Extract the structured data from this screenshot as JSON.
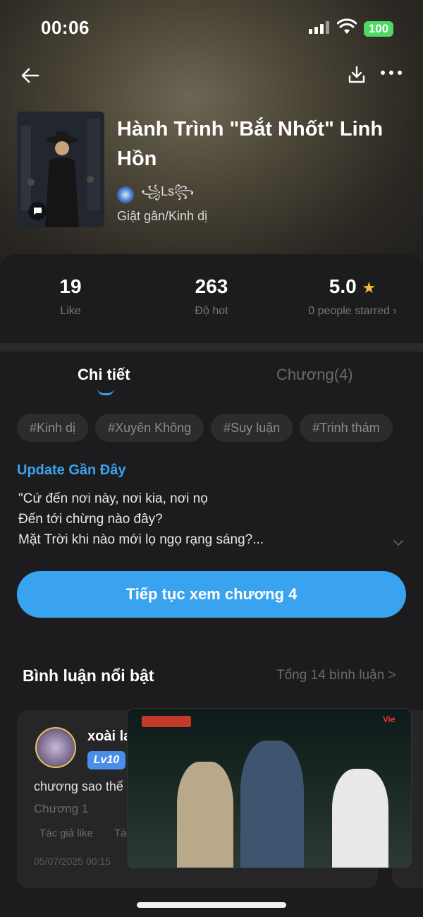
{
  "status_bar": {
    "time": "00:06",
    "battery": "100"
  },
  "book": {
    "title": "Hành Trình \"Bắt Nhốt\" Linh Hồn",
    "author": "꧁Ls꧂",
    "genre": "Giật gân/Kinh dị"
  },
  "stats": [
    {
      "value": "19",
      "label": "Like"
    },
    {
      "value": "263",
      "label": "Độ hot"
    },
    {
      "value": "5.0",
      "label": "0 people starred",
      "has_star": true
    }
  ],
  "tabs": {
    "details": "Chi tiết",
    "chapters": "Chương(4)"
  },
  "tags": [
    "#Kinh dị",
    "#Xuyên Không",
    "#Suy luận",
    "#Trinh thám"
  ],
  "update": {
    "title": "Update Gần Đây",
    "text": "\"Cứ đến nơi này, nơi kia, nơi nọ\n Đến tới chừng nào đây?\n Mặt Trời khi nào mới lọ ngọ rạng sáng?..."
  },
  "continue_button": "Tiếp tục xem chương 4",
  "comments": {
    "title": "Bình luận nổi bật",
    "total": "Tổng 14 bình luận >",
    "items": [
      {
        "name": "xoài la",
        "level": "Lv10",
        "text": "chương sao thế",
        "chapter": "Chương 1",
        "chip": "Tác giả like",
        "chip2": "Tá",
        "date": "05/07/2025 00:15"
      }
    ]
  },
  "colors": {
    "accent": "#3aa3f0",
    "star": "#f5c02a",
    "battery": "#4cd964"
  }
}
